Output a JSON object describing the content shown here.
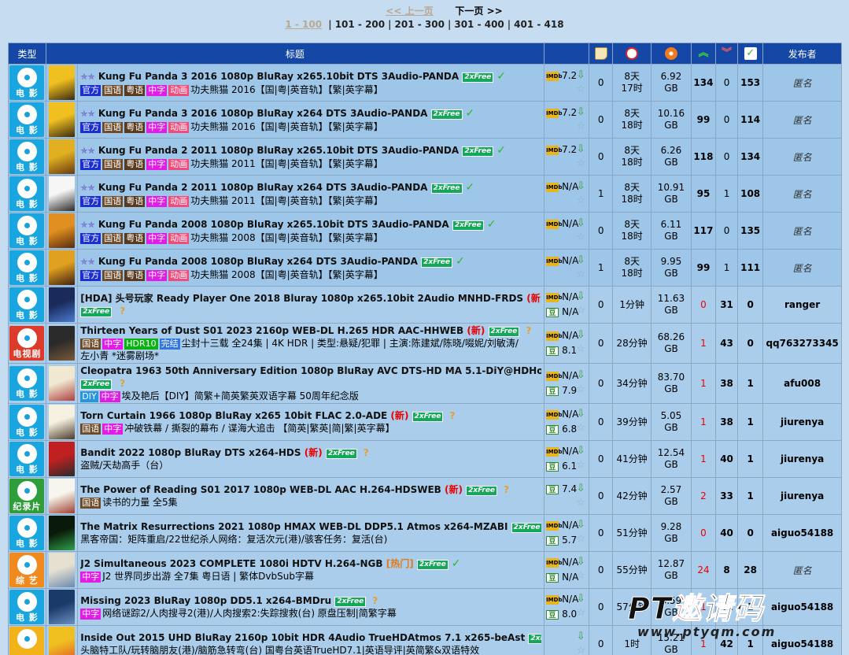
{
  "pager": {
    "prev": "<< 上一页",
    "next": "下一页 >>",
    "current": "1 - 100",
    "ranges": [
      "101 - 200",
      "201 - 300",
      "301 - 400",
      "401 - 418"
    ],
    "separator": "|"
  },
  "headers": {
    "type": "类型",
    "title": "标题",
    "comments_icon": "comment-icon",
    "time_icon": "clock-icon",
    "size_icon": "disc-icon",
    "seeders_icon": "up-arrows-icon",
    "leechers_icon": "down-arrows-icon",
    "completed_icon": "check-list-icon",
    "uploader": "发布者"
  },
  "category_labels": {
    "movie": "电 影",
    "tv": "电视剧",
    "doc": "纪录片",
    "variety": "综 艺"
  },
  "rows": [
    {
      "cat": "movie",
      "stars": "✯✯",
      "title": "Kung Fu Panda 3 2016 1080p BluRay x265.10bit DTS 3Audio-PANDA",
      "free": "2xFree",
      "check": "✓",
      "tags": [
        "官方",
        "国语",
        "粤语",
        "中字",
        "动画"
      ],
      "subtitle": "功夫熊猫 2016【国|粤|英音轨】【繁|英字幕】",
      "imdb": "7.2",
      "douban": "",
      "comments": "0",
      "time": [
        "8天",
        "17时"
      ],
      "size": [
        "6.92",
        "GB"
      ],
      "seeders": "134",
      "leechers": "0",
      "completed": "153",
      "uploader": "匿名",
      "sticky": true
    },
    {
      "cat": "movie",
      "stars": "✯✯",
      "title": "Kung Fu Panda 3 2016 1080p BluRay x264 DTS 3Audio-PANDA",
      "free": "2xFree",
      "check": "✓",
      "tags": [
        "官方",
        "国语",
        "粤语",
        "中字",
        "动画"
      ],
      "subtitle": "功夫熊猫 2016【国|粤|英音轨】【繁|英字幕】",
      "imdb": "7.2",
      "douban": "",
      "comments": "0",
      "time": [
        "8天",
        "18时"
      ],
      "size": [
        "10.16",
        "GB"
      ],
      "seeders": "99",
      "leechers": "0",
      "completed": "114",
      "uploader": "匿名",
      "sticky": true
    },
    {
      "cat": "movie",
      "stars": "✯✯",
      "title": "Kung Fu Panda 2 2011 1080p BluRay x265.10bit DTS 3Audio-PANDA",
      "free": "2xFree",
      "check": "✓",
      "tags": [
        "官方",
        "国语",
        "粤语",
        "中字",
        "动画"
      ],
      "subtitle": "功夫熊猫 2011【国|粤|英音轨】【繁|英字幕】",
      "imdb": "7.2",
      "douban": "",
      "comments": "0",
      "time": [
        "8天",
        "18时"
      ],
      "size": [
        "6.26",
        "GB"
      ],
      "seeders": "118",
      "leechers": "0",
      "completed": "134",
      "uploader": "匿名",
      "sticky": true
    },
    {
      "cat": "movie",
      "stars": "✯✯",
      "title": "Kung Fu Panda 2 2011 1080p BluRay x264 DTS 3Audio-PANDA",
      "free": "2xFree",
      "check": "✓",
      "tags": [
        "官方",
        "国语",
        "粤语",
        "中字",
        "动画"
      ],
      "subtitle": "功夫熊猫 2011【国|粤|英音轨】【繁|英字幕】",
      "imdb": "N/A",
      "douban": "",
      "comments": "1",
      "time": [
        "8天",
        "18时"
      ],
      "size": [
        "10.91",
        "GB"
      ],
      "seeders": "95",
      "leechers": "1",
      "completed": "108",
      "uploader": "匿名",
      "sticky": true
    },
    {
      "cat": "movie",
      "stars": "✯✯",
      "title": "Kung Fu Panda 2008 1080p BluRay x265.10bit DTS 3Audio-PANDA",
      "free": "2xFree",
      "check": "✓",
      "tags": [
        "官方",
        "国语",
        "粤语",
        "中字",
        "动画"
      ],
      "subtitle": "功夫熊猫 2008【国|粤|英音轨】【繁|英字幕】",
      "imdb": "N/A",
      "douban": "",
      "comments": "0",
      "time": [
        "8天",
        "18时"
      ],
      "size": [
        "6.11",
        "GB"
      ],
      "seeders": "117",
      "leechers": "0",
      "completed": "135",
      "uploader": "匿名",
      "sticky": true
    },
    {
      "cat": "movie",
      "stars": "✯✯",
      "title": "Kung Fu Panda 2008 1080p BluRay x264 DTS 3Audio-PANDA",
      "free": "2xFree",
      "check": "✓",
      "tags": [
        "官方",
        "国语",
        "粤语",
        "中字",
        "动画"
      ],
      "subtitle": "功夫熊猫 2008【国|粤|英音轨】【繁|英字幕】",
      "imdb": "N/A",
      "douban": "",
      "comments": "1",
      "time": [
        "8天",
        "18时"
      ],
      "size": [
        "9.95",
        "GB"
      ],
      "seeders": "99",
      "leechers": "1",
      "completed": "111",
      "uploader": "匿名",
      "sticky": true
    },
    {
      "cat": "movie",
      "stars": "",
      "title": "[HDA] 头号玩家 Ready Player One 2018 Bluray 1080p x265.10bit 2Audio MNHD-FRDS",
      "new": "新",
      "free": "2xFree",
      "qm": "?",
      "tags": [],
      "subtitle": "",
      "imdb": "N/A",
      "douban": "N/A",
      "comments": "0",
      "time": [
        "1分钟"
      ],
      "size": [
        "11.63",
        "GB"
      ],
      "seeders": "0",
      "leechers": "31",
      "completed": "0",
      "uploader": "ranger"
    },
    {
      "cat": "tv",
      "stars": "",
      "title": "Thirteen Years of Dust S01 2023 2160p WEB-DL H.265 HDR AAC-HHWEB",
      "new": "新",
      "free": "2xFree",
      "qm": "?",
      "tags": [
        "国语",
        "中字",
        "HDR10",
        "完结"
      ],
      "subtitle": "尘封十三载 全24集 | 4K HDR | 类型:悬疑/犯罪 | 主演:陈建斌/陈晓/啜妮/刘敏涛/",
      "subtitle2": "左小青 *迷雾剧场*",
      "imdb": "N/A",
      "douban": "8.1",
      "comments": "0",
      "time": [
        "28分钟"
      ],
      "size": [
        "68.26",
        "GB"
      ],
      "seeders": "1",
      "leechers": "43",
      "completed": "0",
      "uploader": "qq763273345"
    },
    {
      "cat": "movie",
      "stars": "",
      "title": "Cleopatra 1963 50th Anniversary Edition 1080p BluRay AVC DTS-HD MA 5.1-DiY@HDHome",
      "new": "新",
      "free": "2xFree",
      "qm": "?",
      "freeLine2": true,
      "tags": [
        "DIY",
        "中字"
      ],
      "subtitle": "埃及艳后【DIY】简繁+简英繁英双语字幕 50周年纪念版",
      "imdb": "N/A",
      "douban": "7.9",
      "comments": "0",
      "time": [
        "34分钟"
      ],
      "size": [
        "83.70",
        "GB"
      ],
      "seeders": "1",
      "leechers": "38",
      "completed": "1",
      "uploader": "afu008"
    },
    {
      "cat": "movie",
      "stars": "",
      "title": "Torn Curtain 1966 1080p BluRay x265 10bit FLAC 2.0-ADE",
      "new": "新",
      "free": "2xFree",
      "qm": "?",
      "tags": [
        "国语",
        "中字"
      ],
      "subtitle": "冲破铁幕 / 撕裂的幕布 / 谍海大追击 【简英|繁英|简|繁|英字幕】",
      "imdb": "N/A",
      "douban": "6.8",
      "comments": "0",
      "time": [
        "39分钟"
      ],
      "size": [
        "5.05",
        "GB"
      ],
      "seeders": "1",
      "leechers": "38",
      "completed": "1",
      "uploader": "jiurenya"
    },
    {
      "cat": "movie",
      "stars": "",
      "title": "Bandit 2022 1080p BluRay DTS x264-HDS",
      "new": "新",
      "free": "2xFree",
      "qm": "?",
      "tags": [],
      "subtitle": "盗贼/天劫高手（台）",
      "imdb": "N/A",
      "douban": "6.1",
      "comments": "0",
      "time": [
        "41分钟"
      ],
      "size": [
        "12.54",
        "GB"
      ],
      "seeders": "1",
      "leechers": "40",
      "completed": "1",
      "uploader": "jiurenya"
    },
    {
      "cat": "doc",
      "stars": "",
      "title": "The Power of Reading S01 2017 1080p WEB-DL AAC H.264-HDSWEB",
      "new": "新",
      "free": "2xFree",
      "qm": "?",
      "tags": [
        "国语"
      ],
      "subtitle": "读书的力量 全5集",
      "imdb": "",
      "douban": "7.4",
      "comments": "0",
      "time": [
        "42分钟"
      ],
      "size": [
        "2.57",
        "GB"
      ],
      "seeders": "2",
      "leechers": "33",
      "completed": "1",
      "uploader": "jiurenya"
    },
    {
      "cat": "movie",
      "stars": "",
      "title": "The Matrix Resurrections 2021 1080p HMAX WEB-DL DDP5.1 Atmos x264-MZABI",
      "free": "2xFree",
      "qm": "?",
      "tags": [],
      "subtitle": "黑客帝国：矩阵重启/22世纪杀人网络：复活次元(港)/骇客任务：复活(台)",
      "imdb": "N/A",
      "douban": "5.7",
      "comments": "0",
      "time": [
        "51分钟"
      ],
      "size": [
        "9.28",
        "GB"
      ],
      "seeders": "0",
      "leechers": "40",
      "completed": "0",
      "uploader": "aiguo54188"
    },
    {
      "cat": "variety",
      "stars": "",
      "title": "J2 Simultaneous 2023 COMPLETE 1080i HDTV H.264-NGB",
      "hot": "热门",
      "free": "2xFree",
      "check": "✓",
      "tags": [
        "中字"
      ],
      "subtitle": "J2 世界同步出游 全7集 粤日语 | 繁体DvbSub字幕",
      "imdb": "N/A",
      "douban": "N/A",
      "comments": "0",
      "time": [
        "55分钟"
      ],
      "size": [
        "12.87",
        "GB"
      ],
      "seeders": "24",
      "leechers": "8",
      "completed": "28",
      "uploader": "匿名"
    },
    {
      "cat": "movie",
      "stars": "",
      "title": "Missing 2023 BluRay 1080p DD5.1 x264-BMDru",
      "free": "2xFree",
      "qm": "?",
      "tags": [
        "中字"
      ],
      "subtitle": "网络谜踪2/人肉搜寻2(港)/人肉搜索2:失踪搜救(台) 原盘压制|简繁字幕",
      "imdb": "N/A",
      "douban": "8.0",
      "comments": "0",
      "time": [
        "57分钟"
      ],
      "size": [
        "8.59",
        "GB"
      ],
      "seeders": "1",
      "leechers": "41",
      "completed": "1",
      "uploader": "aiguo54188"
    },
    {
      "cat": "anime",
      "stars": "",
      "title": "Inside Out 2015 UHD BluRay 2160p 10bit HDR 4Audio TrueHDAtmos 7.1 x265-beAst",
      "free": "2xFree",
      "qm": "?",
      "tags": [],
      "subtitle": "头脑特工队/玩转脑朋友(港)/脑筋急转弯(台) 国粤台英语TrueHD7.1|英语导评|英简繁&双语特效",
      "imdb": "",
      "douban": "",
      "comments": "0",
      "time": [
        "1时"
      ],
      "size": [
        "15.21",
        "GB"
      ],
      "seeders": "1",
      "leechers": "42",
      "completed": "1",
      "uploader": "aiguo54188"
    }
  ],
  "watermark": {
    "brand": "PT",
    "brand_red": "邀",
    "brand_tail": "请码",
    "url": "www.ptyqm.com"
  },
  "colors": {
    "header": "#1547a6",
    "row": "#a9cdea",
    "free": "#14a85a",
    "new": "#e00000",
    "movie_cat": "#19a6e0",
    "tv_cat": "#dc3a2a",
    "doc_cat": "#2f9e3a",
    "variety_cat": "#f08a1e"
  }
}
